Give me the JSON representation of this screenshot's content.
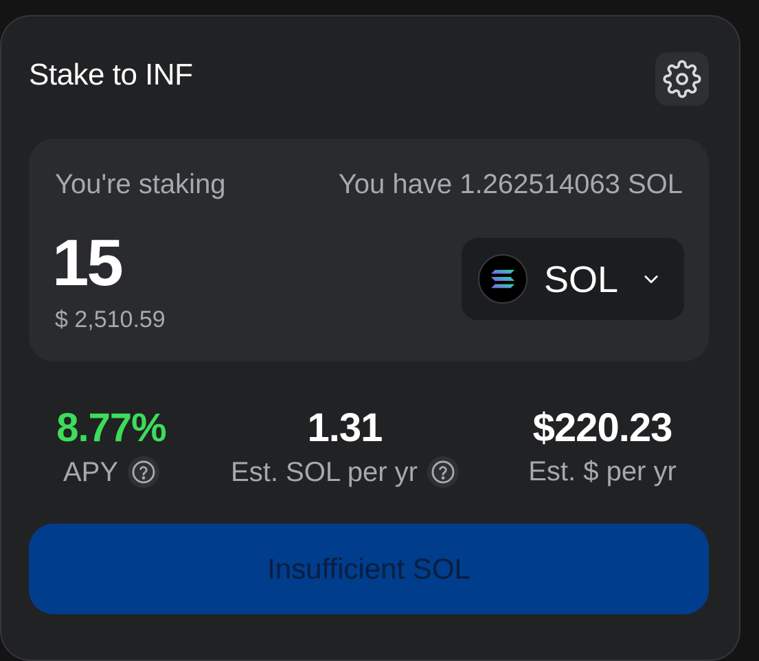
{
  "header": {
    "title": "Stake to INF",
    "settings_icon": "gear-icon"
  },
  "stake": {
    "staking_label": "You're staking",
    "balance_label": "You have 1.262514063 SOL",
    "amount": "15",
    "usd_value": "$ 2,510.59",
    "token": {
      "symbol": "SOL",
      "logo_icon": "solana-logo-icon",
      "dropdown_icon": "chevron-down-icon"
    }
  },
  "stats": {
    "apy": {
      "value": "8.77%",
      "label": "APY",
      "color": "#3ddc5b"
    },
    "sol_per_yr": {
      "value": "1.31",
      "label": "Est. SOL per yr"
    },
    "usd_per_yr": {
      "value": "$220.23",
      "label": "Est. $ per yr"
    }
  },
  "submit": {
    "label": "Insufficient SOL",
    "color": "#003d8c"
  }
}
